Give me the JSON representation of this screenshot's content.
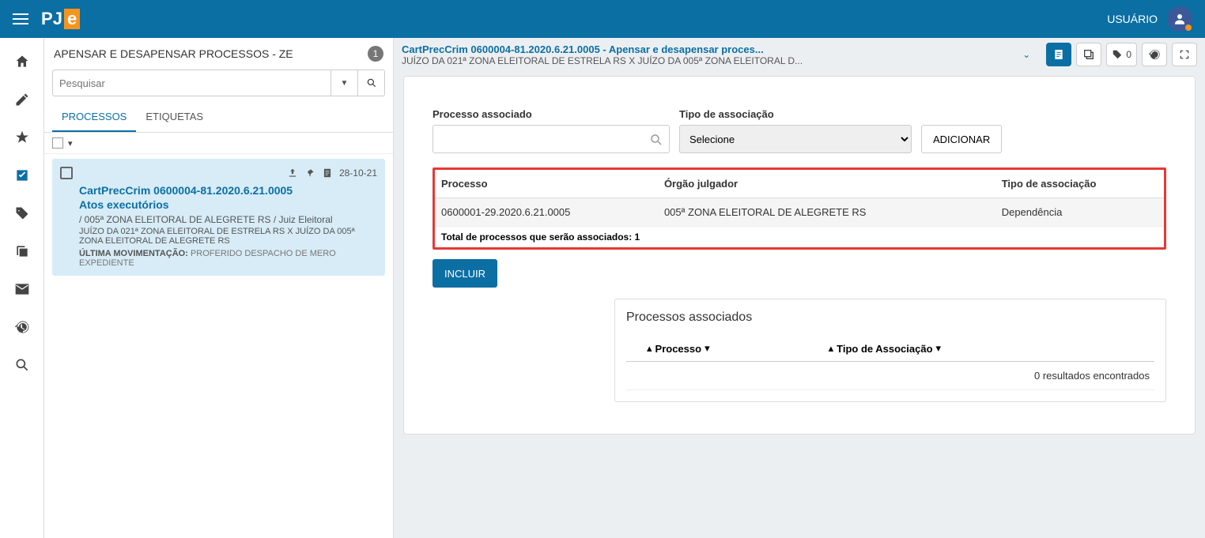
{
  "header": {
    "user": "USUÁRIO"
  },
  "leftPanel": {
    "title": "APENSAR E DESAPENSAR PROCESSOS - ZE",
    "count": "1",
    "searchPlaceholder": "Pesquisar",
    "tabs": [
      "PROCESSOS",
      "ETIQUETAS"
    ],
    "card": {
      "date": "28-10-21",
      "title": "CartPrecCrim 0600004-81.2020.6.21.0005",
      "subtitle": "Atos executórios",
      "line1": "/ 005ª ZONA ELEITORAL DE ALEGRETE RS / Juiz Eleitoral",
      "line2": "JUÍZO DA 021ª ZONA ELEITORAL DE ESTRELA RS X JUÍZO DA 005ª ZONA ELEITORAL DE ALEGRETE RS",
      "movLabel": "ÚLTIMA MOVIMENTAÇÃO:",
      "movText": "PROFERIDO DESPACHO DE MERO EXPEDIENTE"
    }
  },
  "main": {
    "title": "CartPrecCrim 0600004-81.2020.6.21.0005 - Apensar e desapensar proces...",
    "subtitle": "JUÍZO DA 021ª ZONA ELEITORAL DE ESTRELA RS X JUÍZO DA 005ª ZONA ELEITORAL D...",
    "tagCount": "0",
    "form": {
      "assocLabel": "Processo associado",
      "typeLabel": "Tipo de associação",
      "typeValue": "Selecione",
      "addBtn": "ADICIONAR"
    },
    "table": {
      "headers": [
        "Processo",
        "Órgão julgador",
        "Tipo de associação"
      ],
      "rows": [
        [
          "0600001-29.2020.6.21.0005",
          "005ª ZONA ELEITORAL DE ALEGRETE RS",
          "Dependência"
        ]
      ],
      "totalLabel": "Total de processos que serão associados: 1"
    },
    "includeBtn": "INCLUIR",
    "assoc": {
      "title": "Processos associados",
      "col1": "Processo",
      "col2": "Tipo de Associação",
      "empty": "0 resultados encontrados"
    }
  }
}
